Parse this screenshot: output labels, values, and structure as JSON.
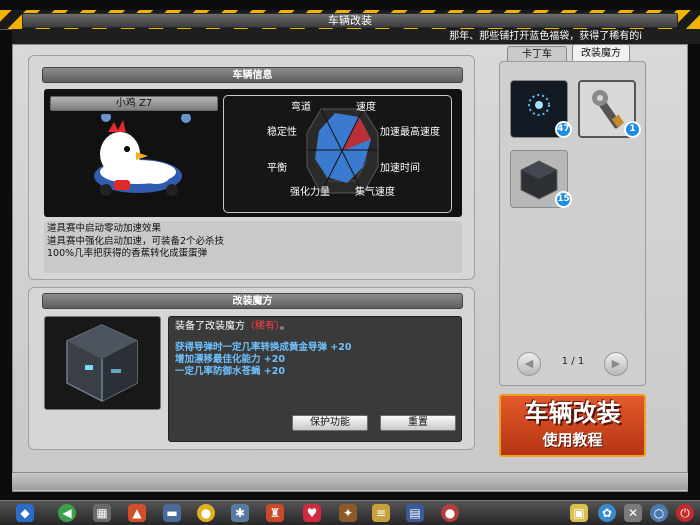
{
  "window": {
    "title": "车辆改装"
  },
  "news": {
    "text": "那年、那些铺打开蓝色福袋，获得了稀有的i"
  },
  "vehicle_info": {
    "header": "车辆信息",
    "name": "小鸡 Z7",
    "stats": {
      "top": "弯道",
      "top_right": "速度",
      "left": "稳定性",
      "right": "加速最高速度",
      "mid_left": "平衡",
      "mid_right": "加速时间",
      "bottom_left": "强化力量",
      "bottom_right": "集气速度"
    },
    "description": [
      "道具赛中启动零动加速效果",
      "道具赛中强化启动加速，可装备2个必杀技",
      "100%几率把获得的香蕉转化成蛋蛋弹"
    ]
  },
  "modification": {
    "header": "改装魔方",
    "equipped_prefix": "装备了改装魔方",
    "equipped_rarity": "（稀有）",
    "equipped_suffix": "。",
    "bonuses": [
      "获得导弹时一定几率转换成黄金导弹 +20",
      "增加漂移最佳化能力 +20",
      "一定几率防御水苍蝇 +20"
    ],
    "protect_button": "保护功能",
    "reset_button": "重置"
  },
  "tabs": {
    "kart": "卡丁车",
    "mod": "改装魔方"
  },
  "inventory": [
    {
      "name": "blue-orb-cube",
      "count": "47"
    },
    {
      "name": "wrench-tool",
      "count": "1"
    },
    {
      "name": "dark-cube",
      "count": "15"
    }
  ],
  "pager": {
    "text": "1 / 1",
    "prev": "◀",
    "next": "▶"
  },
  "tutorial": {
    "line1": "车辆改装",
    "line2": "使用教程"
  },
  "colors": {
    "hazard_yellow": "#f0b400",
    "rarity_red": "#ff4040",
    "bonus_blue": "#6ec2ff",
    "badge_blue": "#1e8de6",
    "tutorial_orange": "#e45a2a"
  },
  "taskbar": {
    "icons": [
      "start-icon",
      "back-icon",
      "cart-icon",
      "flame-icon",
      "shoe-icon",
      "banana-icon",
      "gear-icon",
      "trophy-icon",
      "heart-icon",
      "torch-icon",
      "scroll-icon",
      "book-icon",
      "helmet-icon",
      "note-icon",
      "cluster-icon",
      "tools-icon",
      "search-icon",
      "power-icon"
    ]
  }
}
